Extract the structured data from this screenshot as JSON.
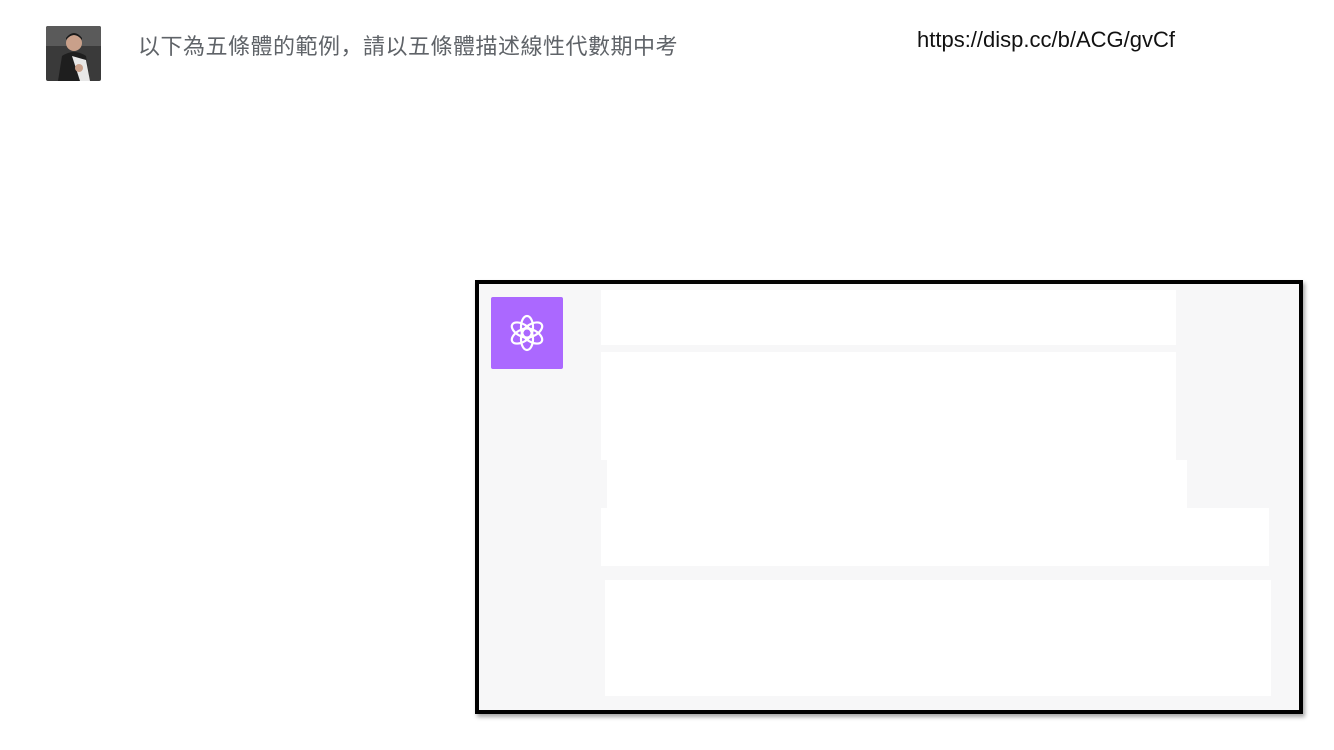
{
  "message": {
    "prompt": "以下為五條體的範例，請以五條體描述線性代數期中考",
    "source_url": "https://disp.cc/b/ACG/gvCf"
  },
  "assistant": {
    "avatar_icon": "openai-logo-icon",
    "avatar_color": "#ab68ff",
    "response_blocks_redacted": true
  }
}
